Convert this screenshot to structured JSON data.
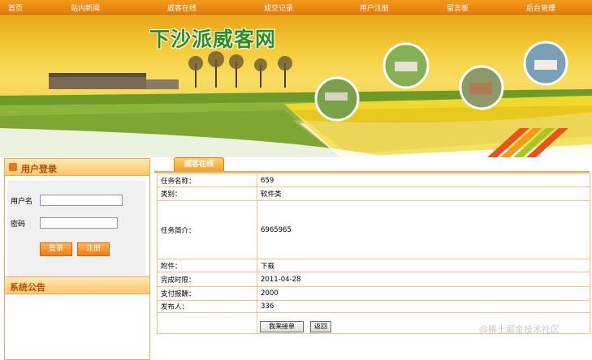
{
  "nav": {
    "items": [
      "首页",
      "站内新闻",
      "威客在线",
      "成交记录",
      "用户注册",
      "留言板",
      "后台管理"
    ]
  },
  "banner": {
    "title": "下沙派威客网"
  },
  "login": {
    "title": "用户登录",
    "username_label": "用户名",
    "password_label": "密码",
    "username_value": "",
    "password_value": "",
    "login_button": "登录",
    "register_button": "注册"
  },
  "notice": {
    "title": "系统公告"
  },
  "main": {
    "tab": "威客在线",
    "rows": [
      {
        "key": "任务名称：",
        "value": "659"
      },
      {
        "key": "类别：",
        "value": "软件类"
      },
      {
        "key": "任务简介：",
        "value": "6965965"
      },
      {
        "key": "附件：",
        "value": "下载"
      },
      {
        "key": "完成时限：",
        "value": "2011-04-28"
      },
      {
        "key": "支付报酬：",
        "value": "2000"
      },
      {
        "key": "发布人：",
        "value": "336"
      }
    ],
    "accept_button": "我来接单",
    "back_button": "返回"
  },
  "watermark": "@稀土掘金技术社区",
  "colors": {
    "nav": "#e98a14",
    "accent": "#f29a1e",
    "title_green": "#2f8d1f"
  }
}
